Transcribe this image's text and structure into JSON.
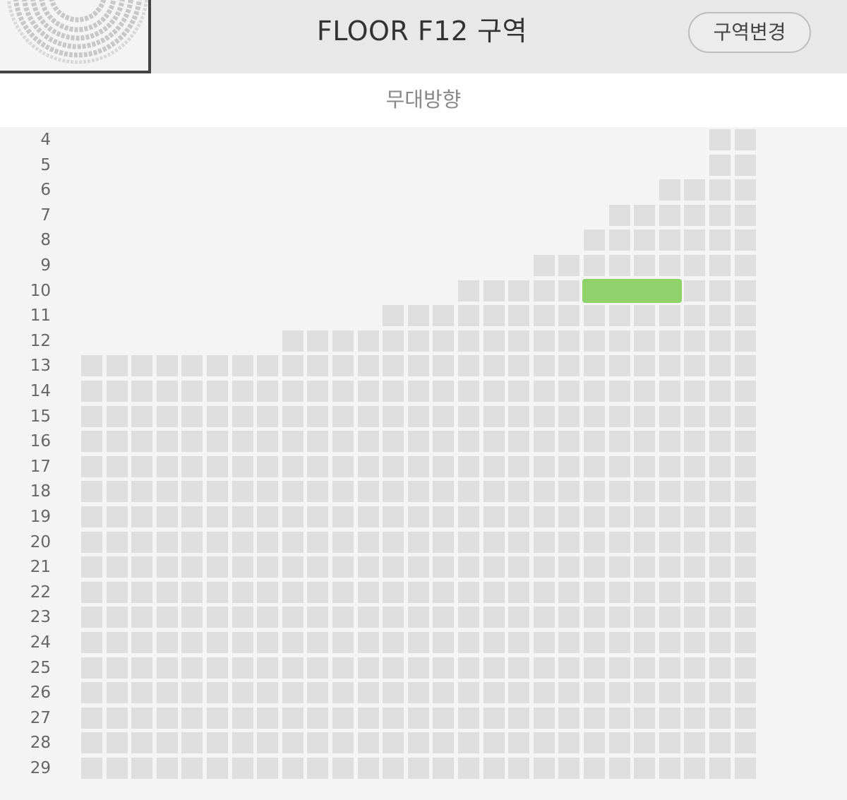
{
  "header": {
    "title": "FLOOR F12 구역",
    "change_button_label": "구역변경"
  },
  "stage": {
    "label": "무대방향"
  },
  "seat_map": {
    "rows": [
      "4",
      "5",
      "6",
      "7",
      "8",
      "9",
      "10",
      "11",
      "12",
      "13",
      "14",
      "15",
      "16",
      "17",
      "18",
      "19",
      "20",
      "21",
      "22",
      "23",
      "24",
      "25",
      "26",
      "27",
      "28",
      "29"
    ],
    "columns_total": 27,
    "first_seat_column_by_row": {
      "4": 26,
      "5": 26,
      "6": 24,
      "7": 22,
      "8": 21,
      "9": 19,
      "10": 16,
      "11": 13,
      "12": 9,
      "13": 1,
      "14": 1,
      "15": 1,
      "16": 1,
      "17": 1,
      "18": 1,
      "19": 1,
      "20": 1,
      "21": 1,
      "22": 1,
      "23": 1,
      "24": 1,
      "25": 1,
      "26": 1,
      "27": 1,
      "28": 1,
      "29": 1
    },
    "selected": {
      "row": "10",
      "columns": [
        21,
        22,
        23,
        24
      ]
    },
    "colors": {
      "seat": "#dedede",
      "selected": "#8fd16a",
      "background": "#f4f4f4"
    }
  }
}
